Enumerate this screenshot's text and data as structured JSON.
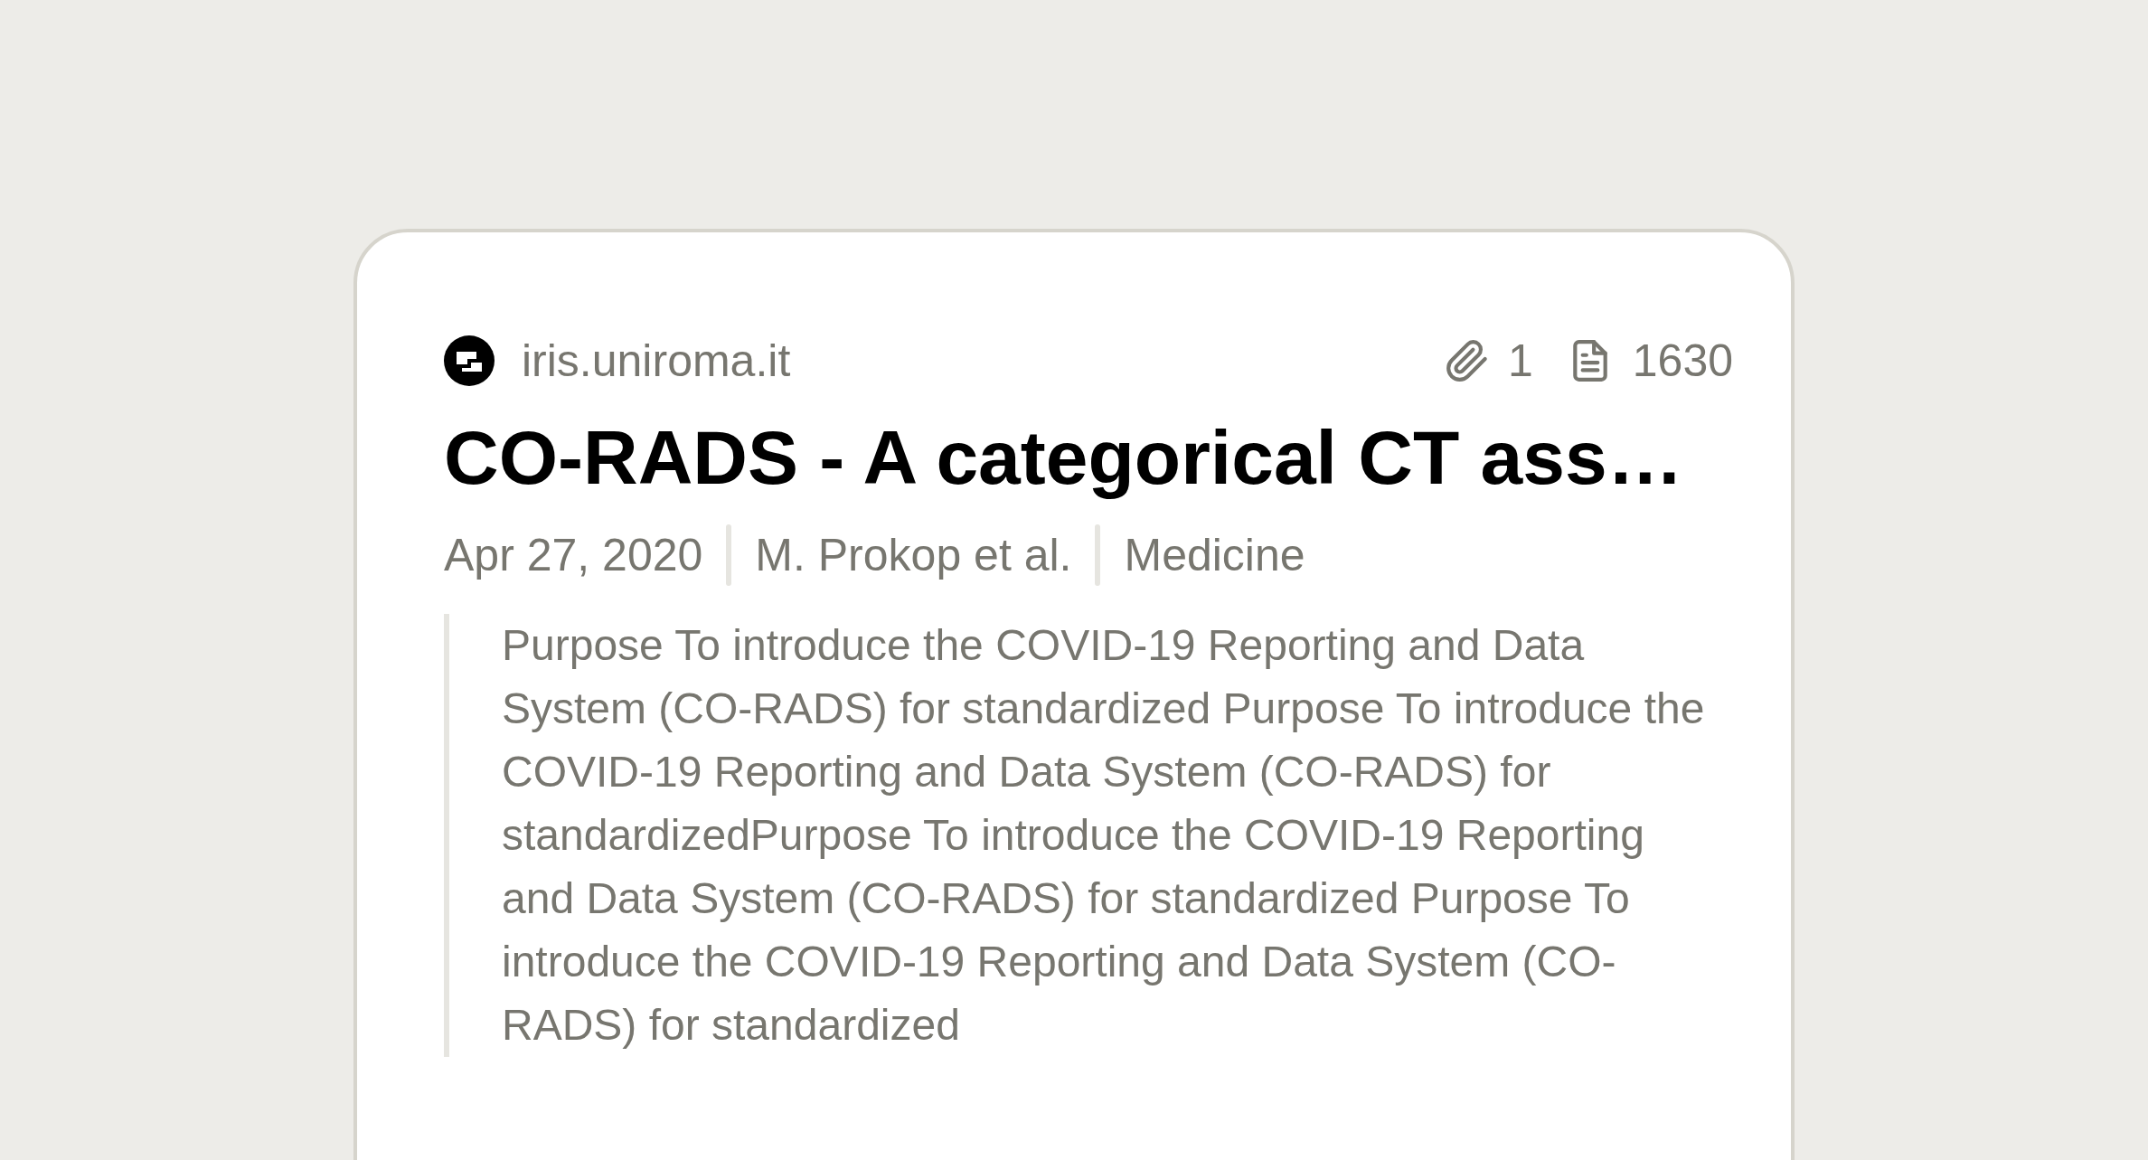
{
  "source": {
    "domain": "iris.uniroma.it"
  },
  "stats": {
    "attachments": "1",
    "pages": "1630"
  },
  "title": "CO-RADS - A categorical CT ass…",
  "meta": [
    "Apr 27, 2020",
    "M. Prokop et al.",
    "Medicine"
  ],
  "abstract": "Purpose To introduce the COVID-19 Reporting and Data System (CO-RADS) for standardized Purpose To introduce the COVID-19 Reporting and Data System (CO-RADS) for standardizedPurpose To introduce the COVID-19 Reporting and Data System (CO-RADS) for standardized Purpose To introduce the COVID-19 Reporting and Data System (CO-RADS) for standardized"
}
